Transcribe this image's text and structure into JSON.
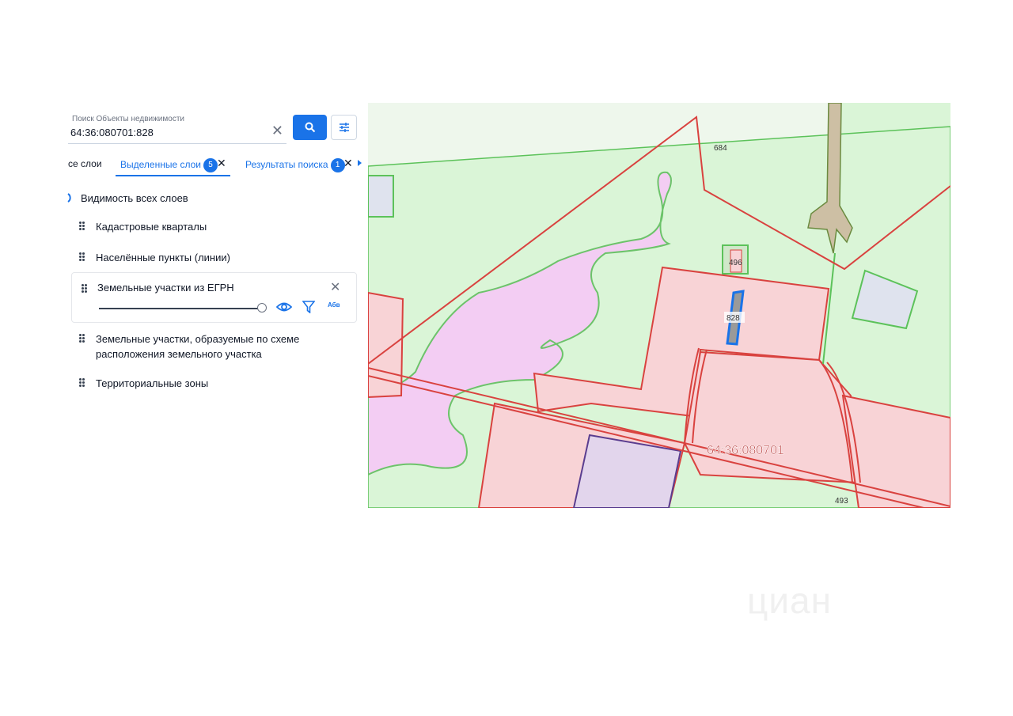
{
  "search": {
    "label": "Поиск Объекты недвижимости",
    "value": "64:36:080701:828"
  },
  "tabs": {
    "all": "се слои",
    "selected": "Выделенные слои",
    "selected_count": "5",
    "results": "Результаты поиска",
    "results_count": "1"
  },
  "layers": {
    "all_visibility": "Видимость всех слоев",
    "items": [
      "Кадастровые кварталы",
      "Населённые пункты (линии)",
      "Земельные участки из ЕГРН",
      "Земельные участки, образуемые по схеме",
      "расположения земельного участка",
      "Территориальные зоны"
    ],
    "opacity_percent": 100,
    "labels_icon": "Абв"
  },
  "map": {
    "labels": [
      "684",
      "496",
      "828",
      "64:36:080701",
      "493"
    ]
  },
  "watermark": "циан",
  "colors": {
    "accent": "#1a73e8",
    "parcel_fill": "#f8d3d6",
    "parcel_border": "#d9423f",
    "greenzone_fill": "#daf5d7",
    "greenzone_border": "#5cc25a",
    "water_fill": "#f3cdf3",
    "highlight": "#1a73e8"
  }
}
